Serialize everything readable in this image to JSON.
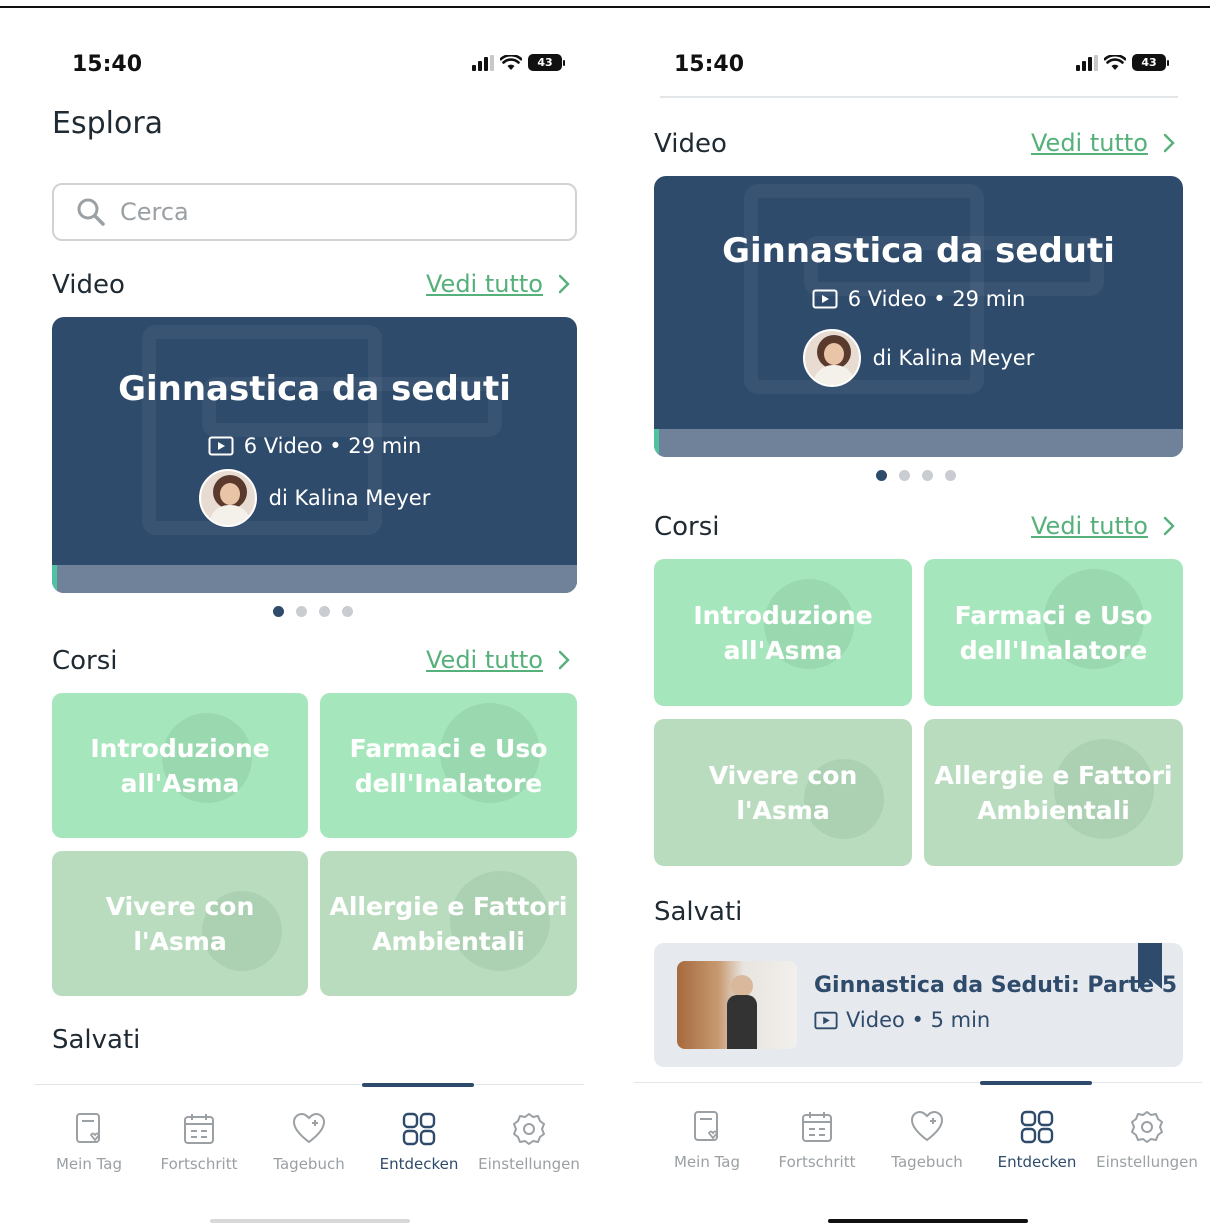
{
  "status": {
    "time": "15:40",
    "battery": "43"
  },
  "page": {
    "title": "Esplora"
  },
  "search": {
    "placeholder": "Cerca"
  },
  "sections": {
    "video": "Video",
    "courses": "Corsi",
    "saved": "Salvati",
    "see_all": "Vedi tutto"
  },
  "video_card": {
    "title": "Ginnastica da seduti",
    "meta": "6 Video • 29 min",
    "author": "di Kalina Meyer"
  },
  "courses": [
    {
      "label": "Introduzione all'Asma"
    },
    {
      "label": "Farmaci e Uso dell'Inalatore"
    },
    {
      "label": "Vivere con l'Asma"
    },
    {
      "label": "Allergie e Fattori Ambientali"
    }
  ],
  "saved_item": {
    "title": "Ginnastica da Seduti: Parte 5",
    "meta": "Video • 5 min"
  },
  "nav": [
    {
      "label": "Mein Tag",
      "icon": "mein-tag-icon"
    },
    {
      "label": "Fortschritt",
      "icon": "calendar-icon"
    },
    {
      "label": "Tagebuch",
      "icon": "heart-plus-icon"
    },
    {
      "label": "Entdecken",
      "icon": "grid-icon",
      "active": true
    },
    {
      "label": "Einstellungen",
      "icon": "gear-icon"
    }
  ],
  "colors": {
    "primary": "#2f4b6b",
    "accent_green": "#56b07a",
    "course_green": "#a6e6bc",
    "course_grey": "#b9dcbf"
  }
}
